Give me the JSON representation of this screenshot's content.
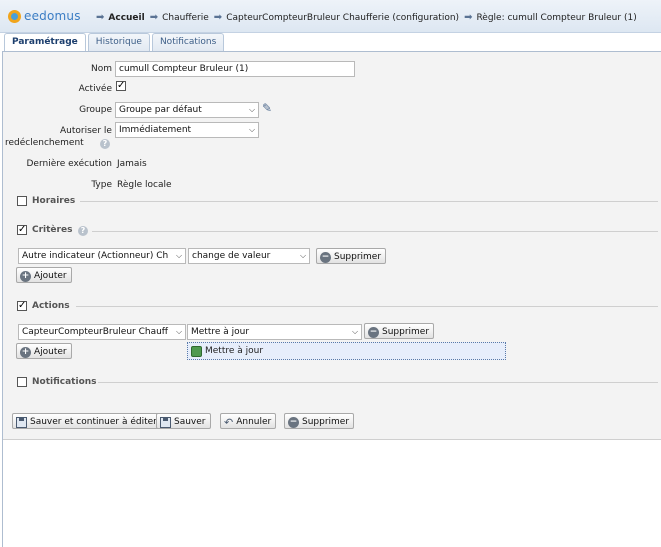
{
  "app": {
    "logo_text": "eedomus"
  },
  "breadcrumbs": [
    "Accueil",
    "Chaufferie",
    "CapteurCompteurBruleur Chaufferie (configuration)",
    "Règle: cumull Compteur Bruleur (1)"
  ],
  "tabs": [
    "Paramétrage",
    "Historique",
    "Notifications"
  ],
  "form": {
    "nom_label": "Nom",
    "nom_value": "cumull Compteur Bruleur (1)",
    "activee_label": "Activée",
    "groupe_label": "Groupe",
    "groupe_value": "Groupe par défaut",
    "autoriser_label_1": "Autoriser le",
    "autoriser_label_2": "redéclenchement",
    "autoriser_value": "Immédiatement",
    "derniere_label": "Dernière exécution",
    "derniere_value": "Jamais",
    "type_label": "Type",
    "type_value": "Règle locale"
  },
  "sections": {
    "horaires": "Horaires",
    "criteres": "Critères",
    "actions": "Actions",
    "notifications": "Notifications"
  },
  "criteres": {
    "indicator_value": "Autre indicateur (Actionneur) Ch",
    "condition_value": "change de valeur",
    "delete_label": "Supprimer",
    "add_label": "Ajouter"
  },
  "actions": {
    "device_value": "CapteurCompteurBruleur Chauff",
    "action_value": "Mettre à jour",
    "delete_label": "Supprimer",
    "add_label": "Ajouter",
    "dropdown_option": "Mettre à jour"
  },
  "bottom_buttons": {
    "save_continue": "Sauver et continuer à éditer",
    "save": "Sauver",
    "cancel": "Annuler",
    "delete": "Supprimer"
  }
}
